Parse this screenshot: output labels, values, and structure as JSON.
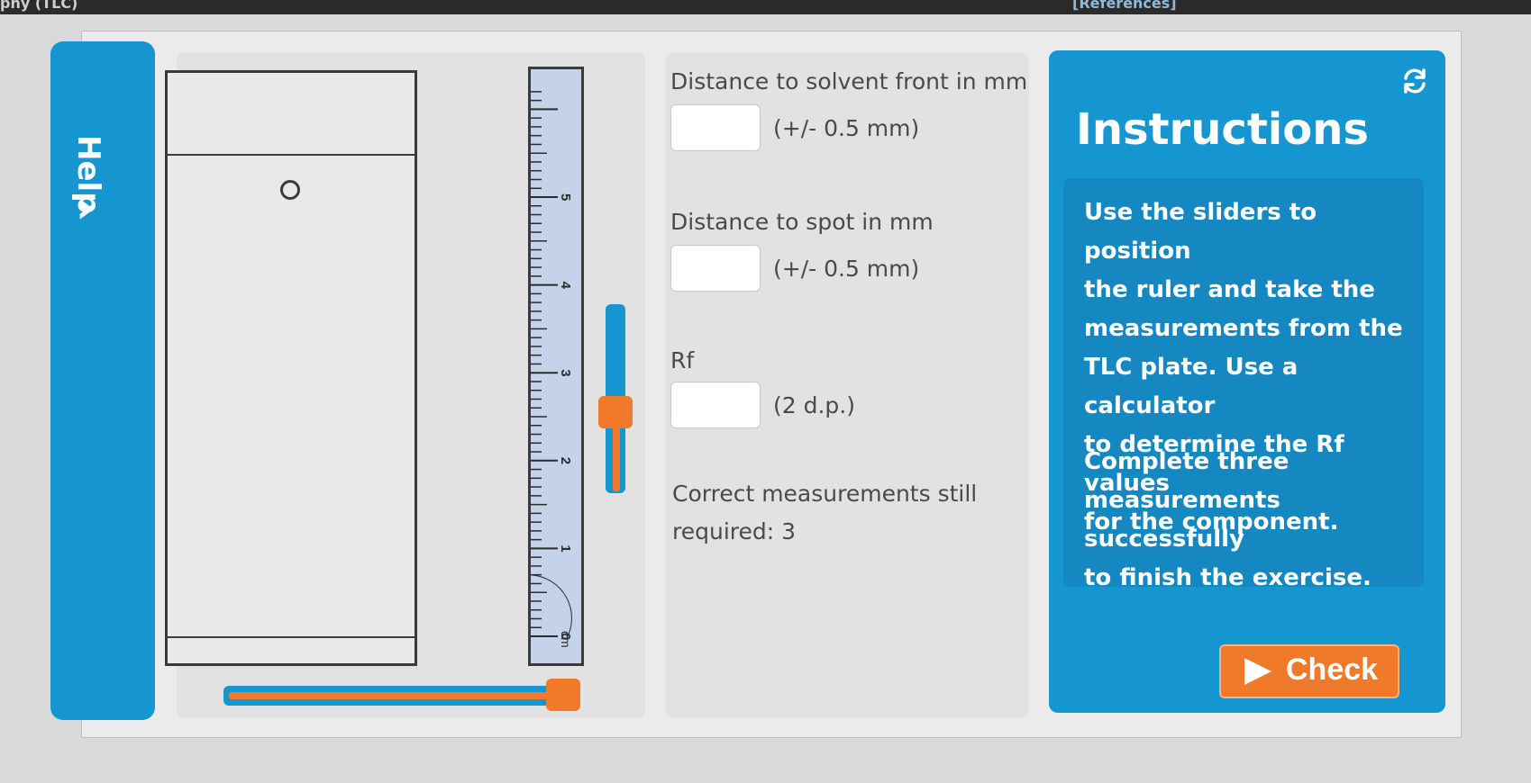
{
  "topbar": {
    "left_text": "phy (TLC)",
    "right_text": "[References]"
  },
  "help": {
    "label": "Help",
    "icon": "chevron-right-icon"
  },
  "ruler": {
    "unit": "cm",
    "labels": [
      "5",
      "4",
      "3",
      "2",
      "1",
      "0"
    ]
  },
  "measurements": {
    "solvent_front": {
      "label": "Distance to solvent front in mm",
      "value": "",
      "tolerance": "(+/- 0.5 mm)"
    },
    "spot": {
      "label": "Distance to spot in mm",
      "value": "",
      "tolerance": "(+/- 0.5 mm)"
    },
    "rf": {
      "label": "Rf",
      "value": "",
      "precision": "(2 d.p.)"
    },
    "remaining_line1": "Correct measurements still",
    "remaining_line2": "required: 3"
  },
  "instructions": {
    "title": "Instructions",
    "para1": [
      "Use the sliders to position",
      "the ruler and take the",
      "measurements from the",
      "TLC plate. Use a calculator",
      "to determine the Rf values",
      "for the component."
    ],
    "para2": [
      "Complete three",
      "measurements successfully",
      "to finish the exercise."
    ],
    "check_label": "Check",
    "refresh_icon": "refresh-icon"
  },
  "colors": {
    "accent": "#1596d1",
    "slider": "#f07a2a",
    "ruler": "#c4d2ea"
  }
}
